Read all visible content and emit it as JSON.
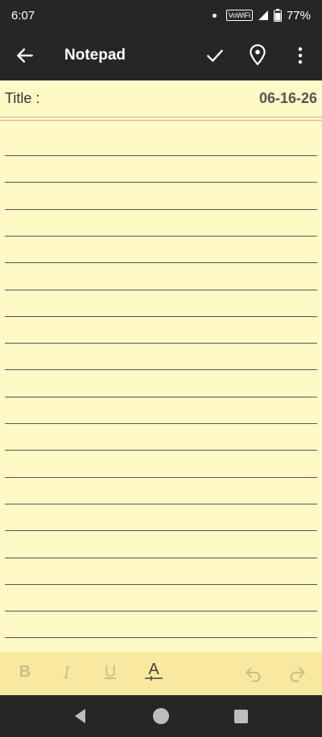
{
  "status_bar": {
    "time": "6:07",
    "vowifi": "VoWiFi",
    "battery": "77%"
  },
  "app_bar": {
    "title": "Notepad",
    "icons": [
      "back-arrow-icon",
      "check-icon",
      "location-pin-icon",
      "more-vert-icon"
    ]
  },
  "note": {
    "title_label": "Title :",
    "date": "06-16-26"
  },
  "format_bar": {
    "bold": "B",
    "italic": "I",
    "underline": "U",
    "text_color": "A"
  },
  "colors": {
    "bar": "#262626",
    "paper": "#fef9c5",
    "format_bar": "#f8e9a0",
    "rule": "#555555",
    "margin_rule": "#e6a8a0"
  }
}
